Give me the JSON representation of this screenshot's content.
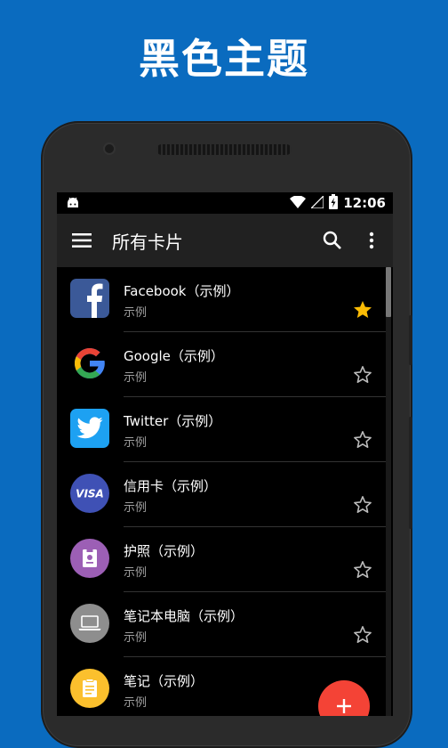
{
  "headline": "黑色主题",
  "status_bar": {
    "time": "12:06"
  },
  "app_bar": {
    "title": "所有卡片",
    "menu_icon": "hamburger-menu-icon",
    "search_icon": "search-icon",
    "more_icon": "overflow-menu-icon"
  },
  "list": {
    "items": [
      {
        "title": "Facebook（示例）",
        "subtitle": "示例",
        "icon": "facebook-logo",
        "starred": true
      },
      {
        "title": "Google（示例）",
        "subtitle": "示例",
        "icon": "google-logo",
        "starred": false
      },
      {
        "title": "Twitter（示例）",
        "subtitle": "示例",
        "icon": "twitter-logo",
        "starred": false
      },
      {
        "title": "信用卡（示例）",
        "subtitle": "示例",
        "icon": "visa-card-icon",
        "starred": false
      },
      {
        "title": "护照（示例）",
        "subtitle": "示例",
        "icon": "passport-icon",
        "starred": false
      },
      {
        "title": "笔记本电脑（示例）",
        "subtitle": "示例",
        "icon": "laptop-icon",
        "starred": false
      },
      {
        "title": "笔记（示例）",
        "subtitle": "示例",
        "icon": "note-icon",
        "starred": false
      }
    ]
  },
  "fab": {
    "icon": "add-icon",
    "label": "+"
  },
  "colors": {
    "background": "#0a6bbf",
    "app_bar": "#212121",
    "star_active": "#fbbc05",
    "fab": "#f44336"
  }
}
